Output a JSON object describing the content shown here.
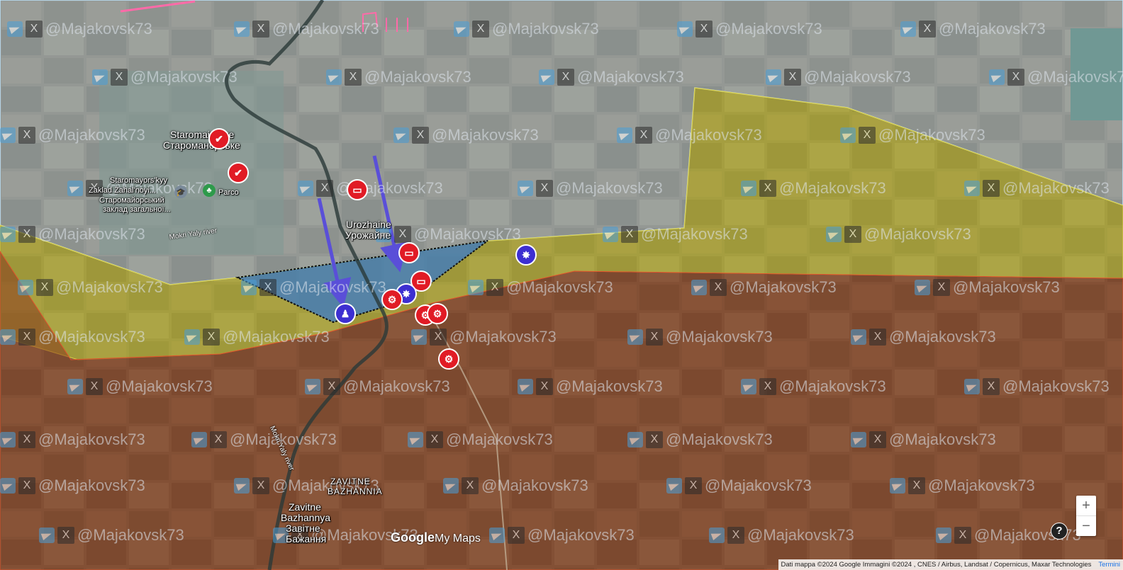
{
  "map": {
    "places": [
      {
        "id": "staromaiorske_lat",
        "text": "Staromaiorske"
      },
      {
        "id": "staromaiorske_cyr",
        "text": "Староманорське"
      },
      {
        "id": "school_lat_1",
        "text": "Staromayors'kyy"
      },
      {
        "id": "school_lat_2",
        "text": "Zaklad Zahal'noyi..."
      },
      {
        "id": "school_cyr_1",
        "text": "Старомайорський"
      },
      {
        "id": "school_cyr_2",
        "text": "заклад загальної..."
      },
      {
        "id": "parco",
        "text": "Parco"
      },
      {
        "id": "urozhaine_lat",
        "text": "Urozhaine"
      },
      {
        "id": "urozhaine_cyr",
        "text": "Урожайне"
      },
      {
        "id": "zavitne_caps_1",
        "text": "ZAVITNE"
      },
      {
        "id": "zavitne_caps_2",
        "text": "BAZHANNIA"
      },
      {
        "id": "zavitne_lat_1",
        "text": "Zavitne"
      },
      {
        "id": "zavitne_lat_2",
        "text": "Bazhannya"
      },
      {
        "id": "zavitne_cyr_1",
        "text": "Завітне"
      },
      {
        "id": "zavitne_cyr_2",
        "text": "Бажання"
      }
    ],
    "river_labels": [
      {
        "text": "Mokri Yaly river"
      },
      {
        "text": "Mokri Yaly river"
      }
    ],
    "watermark_text": "@Majakovsk73",
    "x_icon_glyph": "X",
    "marker_icons": {
      "artillery": "artillery-icon",
      "tank_destroyed": "destroyed-tank-icon",
      "apc_destroyed": "destroyed-apc-icon",
      "explosion": "explosion-icon",
      "infantry": "infantry-icon"
    },
    "colors": {
      "russian_control": "#8b3a1e",
      "contested_gray_zone": "#c8c832",
      "ukrainian_advance": "#3a7ac8",
      "ukrainian_control": "#b8d8f0",
      "red_marker": "#e11b25",
      "blue_marker": "#3d2fd1",
      "arrow": "#5a4fd8"
    }
  },
  "controls": {
    "zoom_in": "+",
    "zoom_out": "−",
    "help": "?"
  },
  "branding": {
    "google": "Google",
    "mymaps": "My Maps"
  },
  "attribution": {
    "text": "Dati mappa ©2024 Google Immagini ©2024 , CNES / Airbus, Landsat / Copernicus, Maxar Technologies",
    "terms": "Termini"
  }
}
